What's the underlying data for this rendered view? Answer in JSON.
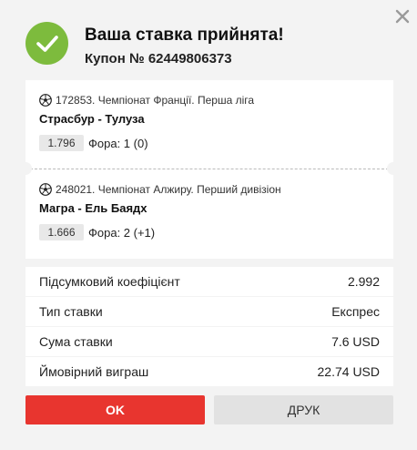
{
  "dialog": {
    "title": "Ваша ставка прийнята!",
    "coupon": "Купон № 62449806373"
  },
  "bets": [
    {
      "league": "172853. Чемпіонат Франції. Перша ліга",
      "match": "Страсбур - Тулуза",
      "odd": "1.796",
      "bet_type": "Фора: 1 (0)"
    },
    {
      "league": "248021. Чемпіонат Алжиру. Перший дивізіон",
      "match": "Магра - Ель Баядх",
      "odd": "1.666",
      "bet_type": "Фора: 2 (+1)"
    }
  ],
  "summary": [
    {
      "label": "Підсумковий коефіцієнт",
      "value": "2.992"
    },
    {
      "label": "Тип ставки",
      "value": "Експрес"
    },
    {
      "label": "Сума ставки",
      "value": "7.6 USD"
    },
    {
      "label": "Ймовірний виграш",
      "value": "22.74 USD"
    }
  ],
  "buttons": {
    "ok": "OK",
    "print": "ДРУК"
  },
  "icons": {
    "close": "close-icon",
    "success": "checkmark-icon",
    "sport": "soccer-ball-icon"
  },
  "colors": {
    "success": "#7dbb3d",
    "primary": "#e8352f",
    "background": "#f3f3f3"
  }
}
